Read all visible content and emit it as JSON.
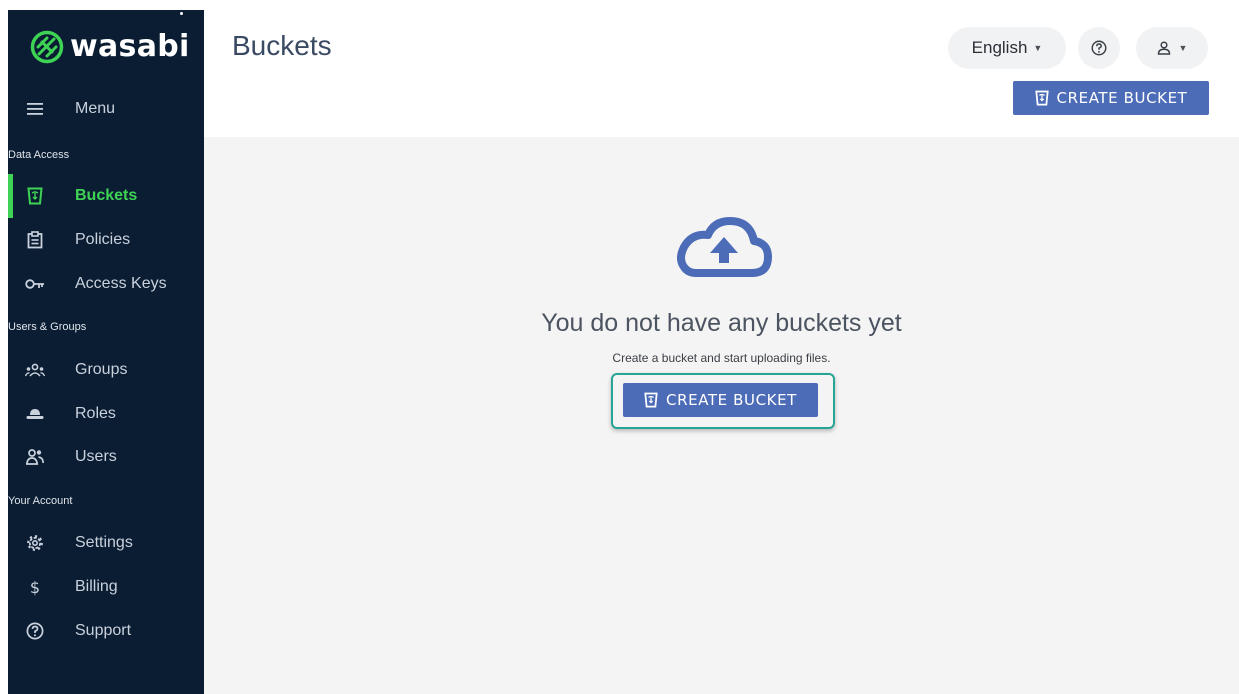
{
  "brand": {
    "name": "wasabi"
  },
  "sidebar": {
    "menu_label": "Menu",
    "sections": [
      {
        "title": "Data Access",
        "items": [
          {
            "label": "Buckets",
            "icon": "bucket-icon",
            "active": true
          },
          {
            "label": "Policies",
            "icon": "clipboard-icon"
          },
          {
            "label": "Access Keys",
            "icon": "key-icon"
          }
        ]
      },
      {
        "title": "Users & Groups",
        "items": [
          {
            "label": "Groups",
            "icon": "groups-icon"
          },
          {
            "label": "Roles",
            "icon": "hat-icon"
          },
          {
            "label": "Users",
            "icon": "users-icon"
          }
        ]
      },
      {
        "title": "Your Account",
        "items": [
          {
            "label": "Settings",
            "icon": "gear-icon"
          },
          {
            "label": "Billing",
            "icon": "dollar-icon"
          },
          {
            "label": "Support",
            "icon": "help-icon"
          }
        ]
      }
    ]
  },
  "header": {
    "title": "Buckets",
    "language": "English",
    "create_label": "CREATE BUCKET"
  },
  "empty_state": {
    "title": "You do not have any buckets yet",
    "subtitle": "Create a bucket and start uploading files.",
    "create_label": "CREATE BUCKET"
  },
  "colors": {
    "sidebar_bg": "#0b1d33",
    "accent_green": "#3ed354",
    "primary_button": "#4d6cb7",
    "focus_ring": "#25a594",
    "content_bg": "#f4f4f4"
  }
}
